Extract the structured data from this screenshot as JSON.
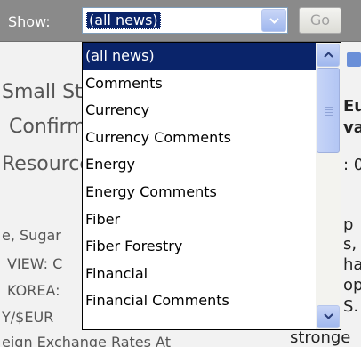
{
  "toolbar": {
    "show_label": "Show:",
    "selected_value": "(all news)",
    "go_label": "Go"
  },
  "dropdown": {
    "items": [
      "(all news)",
      "Comments",
      "Currency",
      "Currency Comments",
      "Energy",
      "Energy Comments",
      "Fiber",
      "Fiber Forestry",
      "Financial",
      "Financial Comments"
    ]
  },
  "background": {
    "left_lines": [
      "Small Stocks",
      "Confirm",
      "Resources"
    ],
    "left_small_lines": [
      "e, Sugar",
      "VIEW: C",
      "KOREA:",
      "Y/$EUR",
      "eign Exchange Rates At"
    ],
    "right_lines": [
      "Eu",
      "va",
      ": 0",
      "p",
      "s,",
      "ha",
      "op",
      "S.",
      "stronge"
    ]
  },
  "colors": {
    "toolbar_bg": "#8a8a8a",
    "selection_bg": "#0a246a",
    "scroll_accent": "#9fb7ee"
  }
}
